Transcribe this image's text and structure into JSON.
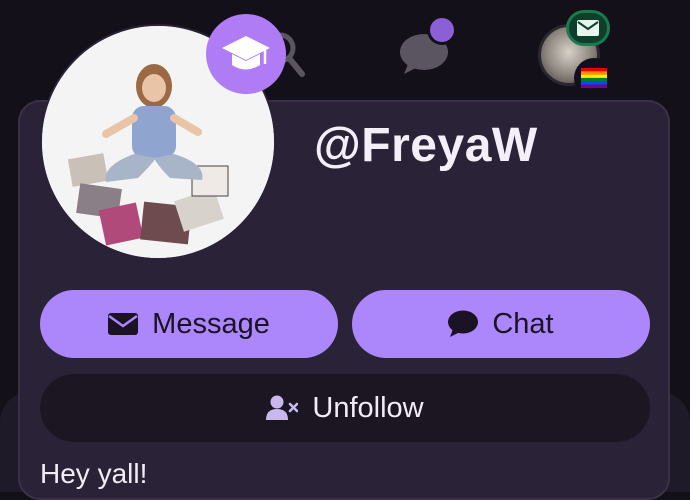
{
  "nav": {
    "search_icon": "search-icon",
    "chat_icon": "chat-bubble-icon",
    "mail_badge_icon": "envelope-icon",
    "pride_flag_icon": "rainbow-flag-icon"
  },
  "profile": {
    "username": "@FreyaW",
    "badge_icon": "graduation-cap-icon",
    "bio": "Hey yall!"
  },
  "actions": {
    "message_label": "Message",
    "chat_label": "Chat",
    "unfollow_label": "Unfollow"
  },
  "colors": {
    "accent": "#ac86fb",
    "badge": "#b07cf6",
    "card_bg": "#2a2236",
    "page_bg": "#141019",
    "mail_badge": "#1a7a4e"
  }
}
